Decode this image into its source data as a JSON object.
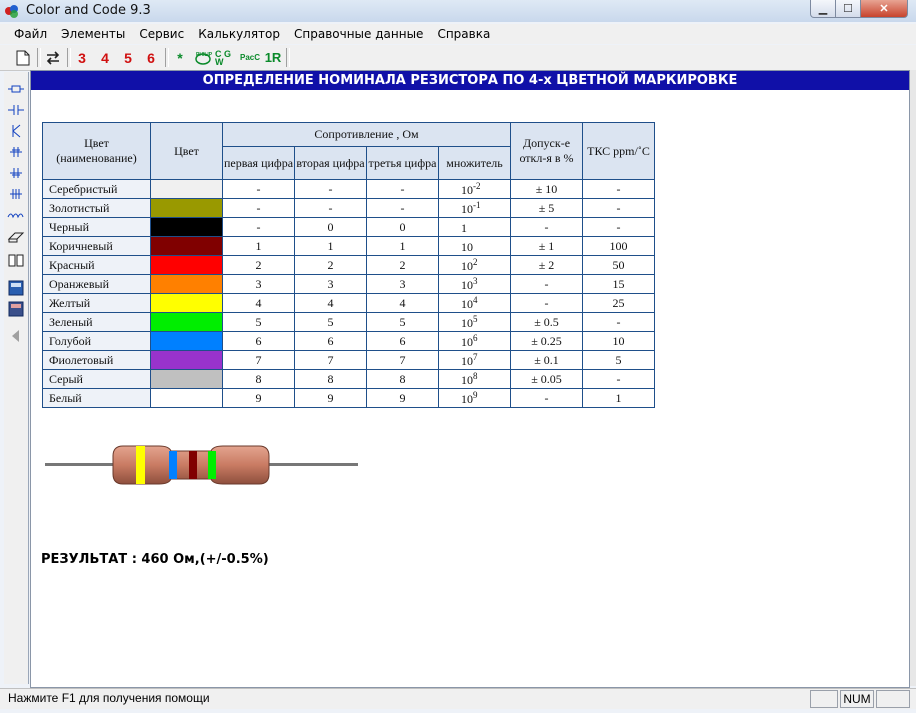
{
  "window": {
    "title": "Color and Code 9.3"
  },
  "menu": [
    "Файл",
    "Элементы",
    "Сервис",
    "Калькулятор",
    "Справочные данные",
    "Справка"
  ],
  "toolbar": {
    "band_buttons": [
      "3",
      "4",
      "5",
      "6"
    ],
    "smd_label": "1R",
    "star_label": "*",
    "cgw_label": "C G W",
    "pac_label": "PacC"
  },
  "banner": "ОПРЕДЕЛЕНИЕ НОМИНАЛА РЕЗИСТОРА ПО 4-х ЦВЕТНОЙ МАРКИРОВКЕ",
  "table": {
    "headers": {
      "color_name": "Цвет (наименование)",
      "color": "Цвет",
      "resistance": "Сопротивление , Ом",
      "first": "первая цифра",
      "second": "вторая цифра",
      "third": "третья цифра",
      "multiplier": "множитель",
      "tolerance": "Допуск-е откл-я в %",
      "tcr": "ТКС ppm/˚C"
    },
    "rows": [
      {
        "name": "Серебристый",
        "color": "#f0f0f0",
        "d1": "-",
        "d2": "-",
        "d3": "-",
        "mult_base": "10",
        "mult_exp": "-2",
        "tol": "± 10",
        "tcr": "-"
      },
      {
        "name": "Золотистый",
        "color": "#999900",
        "d1": "-",
        "d2": "-",
        "d3": "-",
        "mult_base": "10",
        "mult_exp": "-1",
        "tol": "± 5",
        "tcr": "-"
      },
      {
        "name": "Черный",
        "color": "#000000",
        "d1": "-",
        "d2": "0",
        "d3": "0",
        "mult_base": "1",
        "mult_exp": "",
        "tol": "-",
        "tcr": "-"
      },
      {
        "name": "Коричневый",
        "color": "#800000",
        "d1": "1",
        "d2": "1",
        "d3": "1",
        "mult_base": "10",
        "mult_exp": "",
        "tol": "± 1",
        "tcr": "100"
      },
      {
        "name": "Красный",
        "color": "#ff0000",
        "d1": "2",
        "d2": "2",
        "d3": "2",
        "mult_base": "10",
        "mult_exp": "2",
        "tol": "± 2",
        "tcr": "50"
      },
      {
        "name": "Оранжевый",
        "color": "#ff8000",
        "d1": "3",
        "d2": "3",
        "d3": "3",
        "mult_base": "10",
        "mult_exp": "3",
        "tol": "-",
        "tcr": "15"
      },
      {
        "name": "Желтый",
        "color": "#ffff00",
        "d1": "4",
        "d2": "4",
        "d3": "4",
        "mult_base": "10",
        "mult_exp": "4",
        "tol": "-",
        "tcr": "25"
      },
      {
        "name": "Зеленый",
        "color": "#00ee00",
        "d1": "5",
        "d2": "5",
        "d3": "5",
        "mult_base": "10",
        "mult_exp": "5",
        "tol": "± 0.5",
        "tcr": "-"
      },
      {
        "name": "Голубой",
        "color": "#0080ff",
        "d1": "6",
        "d2": "6",
        "d3": "6",
        "mult_base": "10",
        "mult_exp": "6",
        "tol": "± 0.25",
        "tcr": "10"
      },
      {
        "name": "Фиолетовый",
        "color": "#9933cc",
        "d1": "7",
        "d2": "7",
        "d3": "7",
        "mult_base": "10",
        "mult_exp": "7",
        "tol": "± 0.1",
        "tcr": "5"
      },
      {
        "name": "Серый",
        "color": "#c0c0c0",
        "d1": "8",
        "d2": "8",
        "d3": "8",
        "mult_base": "10",
        "mult_exp": "8",
        "tol": "± 0.05",
        "tcr": "-"
      },
      {
        "name": "Белый",
        "color": "#ffffff",
        "d1": "9",
        "d2": "9",
        "d3": "9",
        "mult_base": "10",
        "mult_exp": "9",
        "tol": "-",
        "tcr": "1"
      }
    ]
  },
  "resistor": {
    "body_color": "#c97b63",
    "band_colors": [
      "#ffff00",
      "#0080ff",
      "#800000",
      "#00ee00"
    ]
  },
  "result": "РЕЗУЛЬТАТ : 460 Ом,(+/-0.5%)",
  "status": {
    "text": "Нажмите F1 для получения помощи",
    "num": "NUM"
  },
  "colors": {
    "banner_bg": "#1010a8",
    "table_border": "#1f4f8a",
    "band_button_text": "#d01010",
    "icon_green": "#0a8a2a"
  }
}
